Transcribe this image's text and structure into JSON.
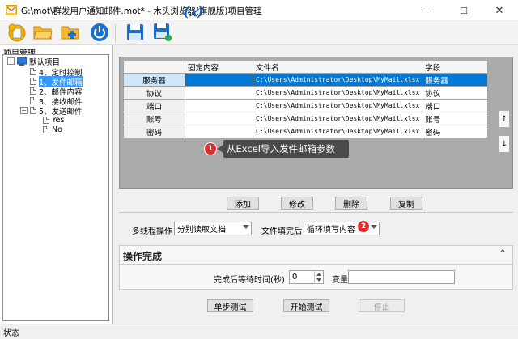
{
  "window": {
    "title": "G:\\mot\\群发用户通知邮件.mot* - 木头浏览器(旗舰版)项目管理",
    "minimize": "—",
    "maximize": "☐",
    "close": "✕"
  },
  "toolbar": {
    "variable_label": "(𝑥)"
  },
  "left_panel": {
    "title": "项目管理",
    "tree": {
      "root": "默认项目",
      "items": [
        "4、定时控制",
        "1、发件邮箱",
        "2、邮件内容",
        "3、接收邮件",
        "5、发送邮件"
      ],
      "subitems": [
        "Yes",
        "No"
      ]
    }
  },
  "grid": {
    "columns": [
      "",
      "固定内容",
      "文件名",
      "字段"
    ],
    "rows": [
      {
        "name": "服务器",
        "fixed": "",
        "file": "C:\\Users\\Administrator\\Desktop\\MyMail.xlsx",
        "field": "服务器"
      },
      {
        "name": "协议",
        "fixed": "",
        "file": "C:\\Users\\Administrator\\Desktop\\MyMail.xlsx",
        "field": "协议"
      },
      {
        "name": "端口",
        "fixed": "",
        "file": "C:\\Users\\Administrator\\Desktop\\MyMail.xlsx",
        "field": "端口"
      },
      {
        "name": "账号",
        "fixed": "",
        "file": "C:\\Users\\Administrator\\Desktop\\MyMail.xlsx",
        "field": "账号"
      },
      {
        "name": "密码",
        "fixed": "",
        "file": "C:\\Users\\Administrator\\Desktop\\MyMail.xlsx",
        "field": "密码"
      }
    ],
    "up_arrow": "↑",
    "down_arrow": "↓"
  },
  "annotations": {
    "badge1": "1",
    "tooltip": "从Excel导入发件邮箱参数",
    "badge2": "2"
  },
  "grid_buttons": {
    "add": "添加",
    "edit": "修改",
    "delete": "删除",
    "copy": "复制"
  },
  "options": {
    "thread_label": "多线程操作",
    "thread_value": "分别读取文档",
    "fill_label": "文件填完后",
    "fill_value": "循环填写内容"
  },
  "completion": {
    "title": "操作完成",
    "collapse": "⌃",
    "wait_label": "完成后等待时间(秒)",
    "wait_value": "0",
    "variable_label": "变量",
    "variable_value": ""
  },
  "actions": {
    "step_test": "单步测试",
    "start_test": "开始测试",
    "stop": "停止"
  },
  "status": {
    "text": "状态"
  }
}
